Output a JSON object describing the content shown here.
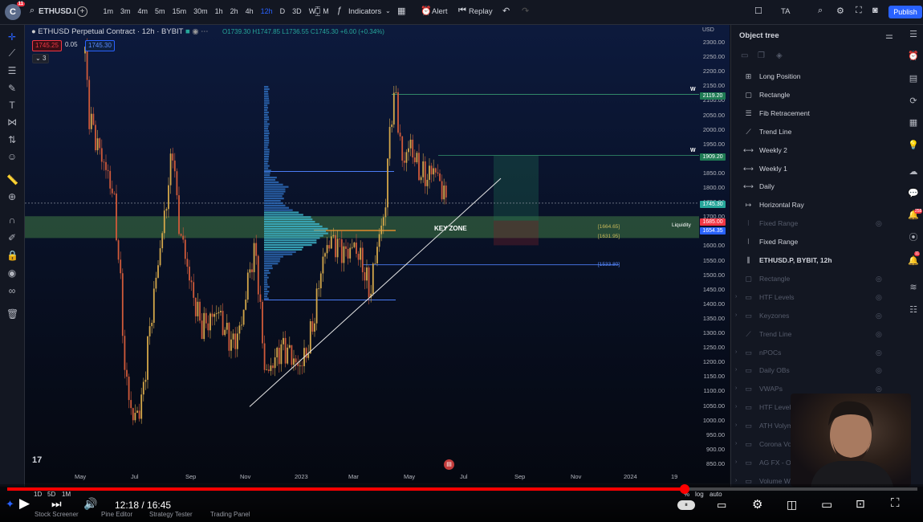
{
  "toolbar": {
    "avatar_letter": "C",
    "avatar_badge": "11",
    "symbol": "ETHUSD.I",
    "intervals": [
      "1m",
      "3m",
      "4m",
      "5m",
      "15m",
      "30m",
      "1h",
      "2h",
      "4h",
      "12h",
      "D",
      "3D",
      "W",
      "M"
    ],
    "active_interval": "12h",
    "indicators_label": "Indicators",
    "alert_label": "Alert",
    "replay_label": "Replay",
    "ta_label": "TA",
    "publish_label": "Publish"
  },
  "chart": {
    "title": "ETHUSD Perpetual Contract · 12h · BYBIT",
    "ohlc": "O1739.30 H1747.85 L1736.55 C1745.30 +6.00 (+0.34%)",
    "bid": "1745.25",
    "spread": "0.05",
    "ask": "1745.30",
    "multiplier": "3",
    "currency": "USD",
    "key_zone_label": "KEY ZONE",
    "liquidity_label": "Liquidity",
    "level_1664": "[1664.65]",
    "level_1631": "[1631.95]",
    "level_1533": "[1533.80]",
    "w_label_1": "W",
    "w_label_2": "W",
    "price_tags": [
      {
        "text": "2119.20",
        "color": "#1e7b54"
      },
      {
        "text": "1909.20",
        "color": "#1e7b54"
      },
      {
        "text": "1745.30",
        "color": "#26a69a"
      },
      {
        "text": "1685.00",
        "color": "#f23645"
      },
      {
        "text": "1654.35",
        "color": "#2962ff"
      }
    ],
    "y_ticks": [
      "2300.00",
      "2250.00",
      "2200.00",
      "2150.00",
      "2100.00",
      "2050.00",
      "2000.00",
      "1950.00",
      "1900.00",
      "1850.00",
      "1800.00",
      "1750.00",
      "1700.00",
      "1650.00",
      "1600.00",
      "1550.00",
      "1500.00",
      "1450.00",
      "1400.00",
      "1350.00",
      "1300.00",
      "1250.00",
      "1200.00",
      "1150.00",
      "1100.00",
      "1050.00",
      "1000.00",
      "950.00",
      "900.00",
      "850.00"
    ],
    "x_ticks": [
      "May",
      "Jul",
      "Sep",
      "Nov",
      "2023",
      "Mar",
      "May",
      "Jul",
      "Sep",
      "Nov",
      "2024",
      "19"
    ],
    "logo": "17"
  },
  "bottom_toolbar": {
    "ranges": [
      "1D",
      "5D",
      "1M"
    ],
    "percent_label": "%",
    "log_label": "log",
    "auto_label": "auto",
    "tabs": [
      "Stock Screener",
      "Pine Editor",
      "Strategy Tester",
      "Trading Panel"
    ]
  },
  "object_tree": {
    "title": "Object tree",
    "items": [
      {
        "label": "Long Position",
        "dim": false,
        "icon": "long-position-icon"
      },
      {
        "label": "Rectangle",
        "dim": false,
        "icon": "rectangle-icon"
      },
      {
        "label": "Fib Retracement",
        "dim": false,
        "icon": "fib-icon"
      },
      {
        "label": "Trend Line",
        "dim": false,
        "icon": "trend-line-icon"
      },
      {
        "label": "Weekly 2",
        "dim": false,
        "icon": "horizontal-line-icon"
      },
      {
        "label": "Weekly 1",
        "dim": false,
        "icon": "horizontal-line-icon"
      },
      {
        "label": "Daily",
        "dim": false,
        "icon": "horizontal-line-icon"
      },
      {
        "label": "Horizontal Ray",
        "dim": false,
        "icon": "horizontal-ray-icon"
      },
      {
        "label": "Fixed Range",
        "dim": true,
        "icon": "fixed-range-icon"
      },
      {
        "label": "Fixed Range",
        "dim": false,
        "icon": "fixed-range-icon"
      },
      {
        "label": "ETHUSD.P, BYBIT, 12h",
        "dim": false,
        "icon": "series-icon"
      },
      {
        "label": "Rectangle",
        "dim": true,
        "icon": "rectangle-icon"
      },
      {
        "label": "HTF Levels",
        "dim": true,
        "icon": "folder-icon"
      },
      {
        "label": "Keyzones",
        "dim": true,
        "icon": "folder-icon"
      },
      {
        "label": "Trend Line",
        "dim": true,
        "icon": "trend-line-icon"
      },
      {
        "label": "nPOCs",
        "dim": true,
        "icon": "folder-icon"
      },
      {
        "label": "Daily OBs",
        "dim": true,
        "icon": "folder-icon"
      },
      {
        "label": "VWAPs",
        "dim": true,
        "icon": "folder-icon"
      },
      {
        "label": "HTF Levels",
        "dim": true,
        "icon": "folder-icon"
      },
      {
        "label": "ATH Volym",
        "dim": true,
        "icon": "folder-icon"
      },
      {
        "label": "Corona Volym",
        "dim": true,
        "icon": "folder-icon"
      },
      {
        "label": "AG FX - OB (6",
        "dim": true,
        "icon": "folder-icon"
      },
      {
        "label": "Volume Weigh",
        "dim": true,
        "icon": "folder-icon"
      }
    ]
  },
  "player": {
    "time": "12:18 / 16:45",
    "progress": 0.744
  }
}
